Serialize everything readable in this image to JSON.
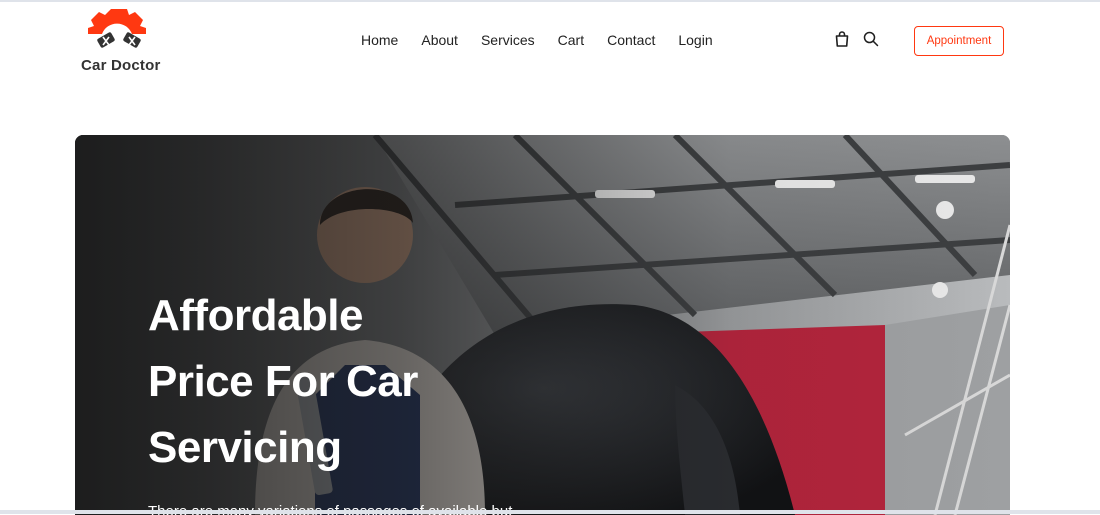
{
  "brand": {
    "name": "Car Doctor",
    "accent": "#ff3811"
  },
  "nav": {
    "links": [
      "Home",
      "About",
      "Services",
      "Cart",
      "Contact",
      "Login"
    ],
    "icons": [
      "shopping-bag-icon",
      "search-icon"
    ],
    "appointment_label": "Appointment"
  },
  "hero": {
    "title_lines": [
      "Affordable",
      "Price For Car",
      "Servicing"
    ],
    "description": "There are many variations of passages of available but"
  },
  "colors": {
    "overlay": "#151515",
    "accent": "#ff3811",
    "text": "#222222"
  }
}
